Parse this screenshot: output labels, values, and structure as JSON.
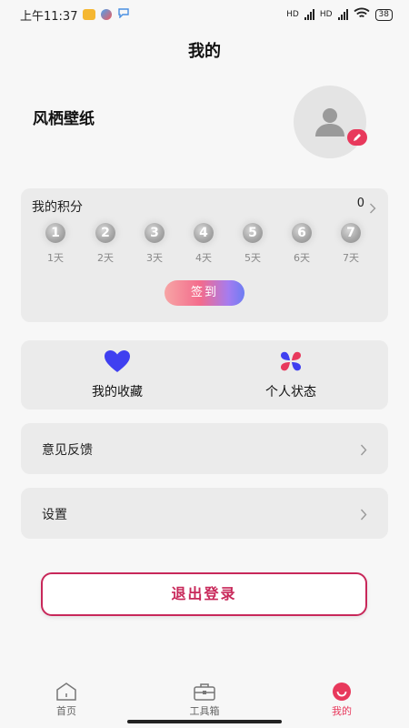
{
  "status_bar": {
    "time": "上午11:37",
    "network_label_1": "HD",
    "network_label_2": "HD",
    "battery": "38"
  },
  "header": {
    "title": "我的"
  },
  "profile": {
    "name": "风栖壁纸"
  },
  "points": {
    "title": "我的积分",
    "count": "0",
    "days": [
      {
        "num": "1",
        "label": "1天"
      },
      {
        "num": "2",
        "label": "2天"
      },
      {
        "num": "3",
        "label": "3天"
      },
      {
        "num": "4",
        "label": "4天"
      },
      {
        "num": "5",
        "label": "5天"
      },
      {
        "num": "6",
        "label": "6天"
      },
      {
        "num": "7",
        "label": "7天"
      }
    ],
    "checkin_label": "签到"
  },
  "quick": {
    "favorites_label": "我的收藏",
    "status_label": "个人状态"
  },
  "menu": {
    "feedback_label": "意见反馈",
    "settings_label": "设置"
  },
  "logout_label": "退出登录",
  "nav": {
    "home_label": "首页",
    "tools_label": "工具箱",
    "mine_label": "我的"
  },
  "colors": {
    "accent": "#e8395c",
    "logout": "#c8285a",
    "heart": "#3f3ff0"
  }
}
